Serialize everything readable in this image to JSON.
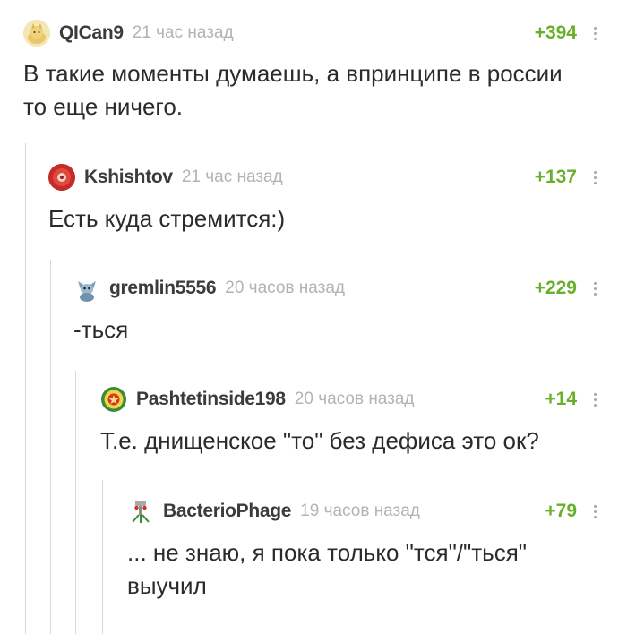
{
  "comments": [
    {
      "username": "QICan9",
      "time": "21 час назад",
      "rating": "+394",
      "text_lines": [
        "В такие моменты думаешь, а впринципе в россии",
        "то еще ничего."
      ]
    },
    {
      "username": "Kshishtov",
      "time": "21 час назад",
      "rating": "+137",
      "text_lines": [
        "Есть куда стремится:)"
      ]
    },
    {
      "username": "gremlin5556",
      "time": "20 часов назад",
      "rating": "+229",
      "text_lines": [
        "-ться"
      ]
    },
    {
      "username": "Pashtetinside198",
      "time": "20 часов назад",
      "rating": "+14",
      "text_lines": [
        "Т.е. днищенское \"то\" без дефиса это ок?"
      ]
    },
    {
      "username": "BacterioPhage",
      "time": "19 часов назад",
      "rating": "+79",
      "text_lines": [
        "... не знаю, я пока только \"тся\"/\"ться\"",
        "выучил"
      ]
    }
  ],
  "colors": {
    "rating": "#68b02a",
    "username": "#3b3b3b",
    "time": "#b3b3b3",
    "thread_line": "#d9d9d9"
  }
}
